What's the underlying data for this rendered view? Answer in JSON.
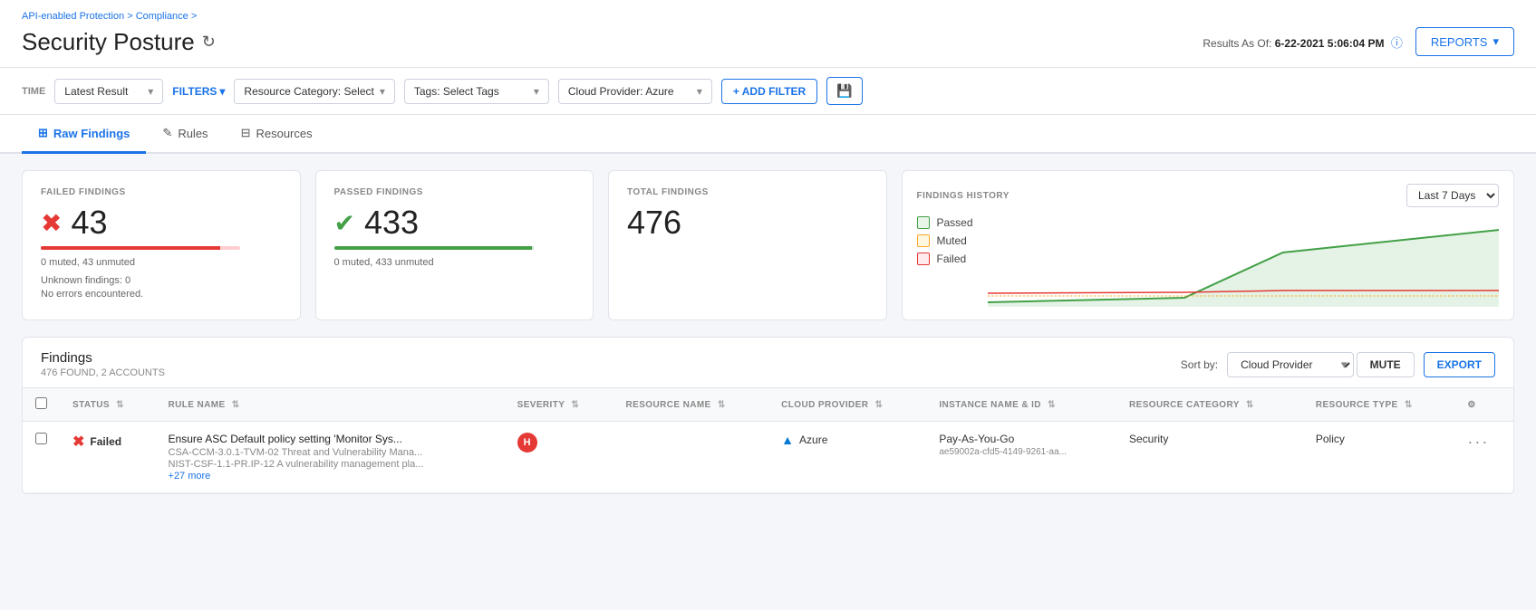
{
  "breadcrumb": {
    "part1": "API-enabled Protection",
    "separator1": " > ",
    "part2": "Compliance",
    "separator2": " > "
  },
  "page": {
    "title": "Security Posture",
    "results_as_of_label": "Results As Of:",
    "results_as_of_value": "6-22-2021 5:06:04 PM"
  },
  "toolbar": {
    "reports_label": "REPORTS",
    "time_label": "TIME",
    "filters_label": "FILTERS",
    "latest_result_label": "Latest Result",
    "resource_category_label": "Resource Category: Select",
    "tags_label": "Tags: Select Tags",
    "cloud_provider_label": "Cloud Provider: Azure",
    "add_filter_label": "+ ADD FILTER",
    "save_icon": "💾"
  },
  "tabs": [
    {
      "id": "raw-findings",
      "label": "Raw Findings",
      "icon": "⊞",
      "active": true
    },
    {
      "id": "rules",
      "label": "Rules",
      "icon": "✎",
      "active": false
    },
    {
      "id": "resources",
      "label": "Resources",
      "icon": "⊟",
      "active": false
    }
  ],
  "metrics": {
    "failed": {
      "label": "FAILED FINDINGS",
      "value": "43",
      "sub1": "0 muted, 43 unmuted",
      "sub2": "Unknown findings: 0",
      "sub3": "No errors encountered."
    },
    "passed": {
      "label": "PASSED FINDINGS",
      "value": "433",
      "sub1": "0 muted, 433 unmuted"
    },
    "total": {
      "label": "TOTAL FINDINGS",
      "value": "476"
    },
    "history": {
      "label": "FINDINGS HISTORY",
      "dropdown_value": "Last 7 Days",
      "legend": {
        "passed": "Passed",
        "muted": "Muted",
        "failed": "Failed"
      }
    }
  },
  "findings": {
    "title": "Findings",
    "subtitle": "476 FOUND, 2 ACCOUNTS",
    "sort_by_label": "Sort by:",
    "sort_by_value": "Cloud Provider",
    "mute_label": "MUTE",
    "export_label": "EXPORT",
    "columns": [
      {
        "id": "status",
        "label": "STATUS"
      },
      {
        "id": "rule-name",
        "label": "RULE NAME"
      },
      {
        "id": "severity",
        "label": "SEVERITY"
      },
      {
        "id": "resource-name",
        "label": "RESOURCE NAME"
      },
      {
        "id": "cloud-provider",
        "label": "CLOUD PROVIDER"
      },
      {
        "id": "instance-name",
        "label": "INSTANCE NAME & ID"
      },
      {
        "id": "resource-category",
        "label": "RESOURCE CATEGORY"
      },
      {
        "id": "resource-type",
        "label": "RESOURCE TYPE"
      }
    ],
    "rows": [
      {
        "status": "Failed",
        "rule_name": "Ensure ASC Default policy setting 'Monitor Sys...",
        "rule_sub1": "CSA-CCM-3.0.1-TVM-02 Threat and Vulnerability Mana...",
        "rule_sub2": "NIST-CSF-1.1-PR.IP-12 A vulnerability management pla...",
        "rule_more": "+27 more",
        "severity": "H",
        "resource_name": "",
        "cloud_provider": "Azure",
        "instance_name": "Pay-As-You-Go",
        "instance_id": "ae59002a-cfd5-4149-9261-aa...",
        "resource_category": "Security",
        "resource_type": "Policy"
      }
    ]
  }
}
